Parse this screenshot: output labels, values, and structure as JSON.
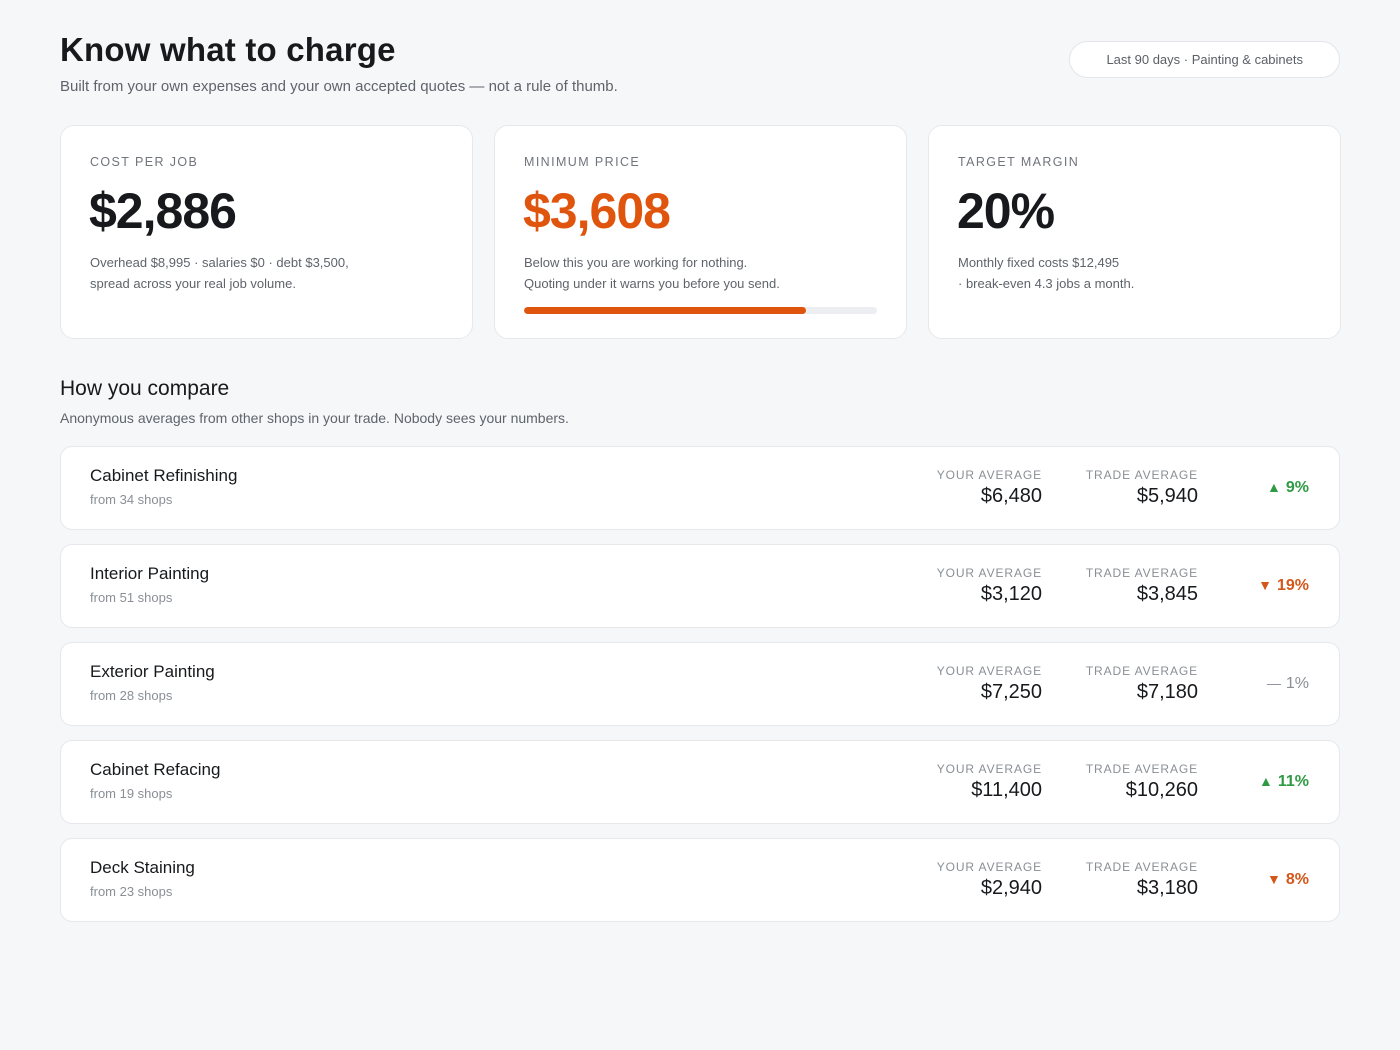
{
  "header": {
    "title": "Know what to charge",
    "subtitle": "Built from your own expenses and your own accepted quotes — not a rule of thumb.",
    "range_filter": "Last 90 days · Painting & cabinets"
  },
  "kpis": [
    {
      "label": "COST PER JOB",
      "value": "$2,886",
      "note_line1": "Overhead $8,995 · salaries $0 · debt $3,500,",
      "note_line2": "spread across your real job volume."
    },
    {
      "label": "MINIMUM PRICE",
      "value": "$3,608",
      "note_line1": "Below this you are working for nothing.",
      "note_line2": "Quoting under it warns you before you send.",
      "progress": 0.8,
      "accent_color": "#e0550e"
    },
    {
      "label": "TARGET MARGIN",
      "value": "20%",
      "note_line1": "Monthly fixed costs $12,495",
      "note_line2": "· break-even 4.3 jobs a month."
    }
  ],
  "compare": {
    "title": "How you compare",
    "subtitle": "Anonymous averages from other shops in your trade. Nobody sees your numbers.",
    "your_label": "YOUR AVERAGE",
    "trade_label": "TRADE AVERAGE",
    "rows": [
      {
        "name": "Cabinet Refinishing",
        "shops": "from 34 shops",
        "yours": "$6,480",
        "trade": "$5,940",
        "direction": "up",
        "icon": "triangle-up-icon",
        "delta": "9%"
      },
      {
        "name": "Interior Painting",
        "shops": "from 51 shops",
        "yours": "$3,120",
        "trade": "$3,845",
        "direction": "down",
        "icon": "triangle-down-icon",
        "delta": "19%"
      },
      {
        "name": "Exterior Painting",
        "shops": "from 28 shops",
        "yours": "$7,250",
        "trade": "$7,180",
        "direction": "flat",
        "icon": "dash-icon",
        "delta": "1%"
      },
      {
        "name": "Cabinet Refacing",
        "shops": "from 19 shops",
        "yours": "$11,400",
        "trade": "$10,260",
        "direction": "up",
        "icon": "triangle-up-icon",
        "delta": "11%"
      },
      {
        "name": "Deck Staining",
        "shops": "from 23 shops",
        "yours": "$2,940",
        "trade": "$3,180",
        "direction": "down",
        "icon": "triangle-down-icon",
        "delta": "8%"
      }
    ]
  },
  "colors": {
    "accent": "#e0550e",
    "positive": "#2f9a44",
    "negative": "#d4571a",
    "neutral": "#8a8f96"
  }
}
